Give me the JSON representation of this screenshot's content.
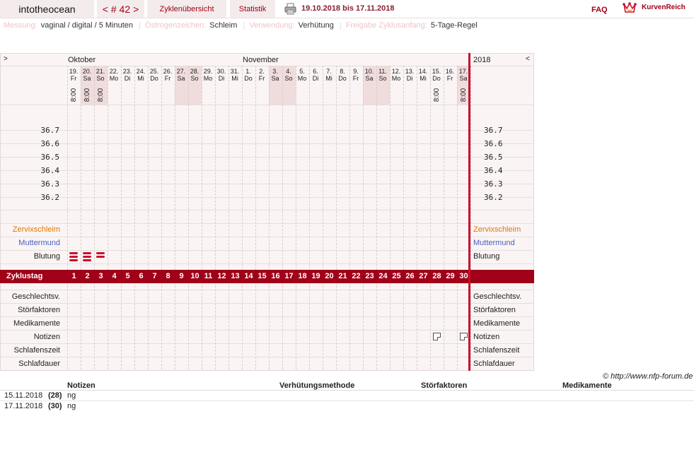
{
  "header": {
    "username": "intotheocean",
    "nav": {
      "prev": "<",
      "cycle": "# 42",
      "next": ">"
    },
    "tabs": [
      "Zyklenübersicht",
      "Statistik"
    ],
    "print_icon": "printer-icon",
    "date_range": "19.10.2018 bis 17.11.2018",
    "faq": "FAQ",
    "brand": "KurvenReich",
    "brand_icon": "crown-icon"
  },
  "info": [
    {
      "label": "Messung:",
      "value": "vaginal / digital / 5 Minuten"
    },
    {
      "label": "Östrogenzeichen:",
      "value": "Schleim"
    },
    {
      "label": "Verwendung:",
      "value": "Verhütung"
    },
    {
      "label": "Freigabe Zyklusanfang:",
      "value": "5-Tage-Regel"
    }
  ],
  "chart": {
    "nav_left": ">",
    "nav_right": "<",
    "month1": "Oktober",
    "month2": "November",
    "year": "2018",
    "days": [
      {
        "d": "19.",
        "w": "Fr",
        "t": "8:00",
        "we": false
      },
      {
        "d": "20.",
        "w": "Sa",
        "t": "8:00",
        "we": true
      },
      {
        "d": "21.",
        "w": "So",
        "t": "8:00",
        "we": true
      },
      {
        "d": "22.",
        "w": "Mo",
        "t": "",
        "we": false
      },
      {
        "d": "23.",
        "w": "Di",
        "t": "",
        "we": false
      },
      {
        "d": "24.",
        "w": "Mi",
        "t": "",
        "we": false
      },
      {
        "d": "25.",
        "w": "Do",
        "t": "",
        "we": false
      },
      {
        "d": "26.",
        "w": "Fr",
        "t": "",
        "we": false
      },
      {
        "d": "27.",
        "w": "Sa",
        "t": "",
        "we": true
      },
      {
        "d": "28.",
        "w": "So",
        "t": "",
        "we": true
      },
      {
        "d": "29.",
        "w": "Mo",
        "t": "",
        "we": false
      },
      {
        "d": "30.",
        "w": "Di",
        "t": "",
        "we": false
      },
      {
        "d": "31.",
        "w": "Mi",
        "t": "",
        "we": false
      },
      {
        "d": "1.",
        "w": "Do",
        "t": "",
        "we": false
      },
      {
        "d": "2.",
        "w": "Fr",
        "t": "",
        "we": false
      },
      {
        "d": "3.",
        "w": "Sa",
        "t": "",
        "we": true
      },
      {
        "d": "4.",
        "w": "So",
        "t": "",
        "we": true
      },
      {
        "d": "5.",
        "w": "Mo",
        "t": "",
        "we": false
      },
      {
        "d": "6.",
        "w": "Di",
        "t": "",
        "we": false
      },
      {
        "d": "7.",
        "w": "Mi",
        "t": "",
        "we": false
      },
      {
        "d": "8.",
        "w": "Do",
        "t": "",
        "we": false
      },
      {
        "d": "9.",
        "w": "Fr",
        "t": "",
        "we": false
      },
      {
        "d": "10.",
        "w": "Sa",
        "t": "",
        "we": true
      },
      {
        "d": "11.",
        "w": "So",
        "t": "",
        "we": true
      },
      {
        "d": "12.",
        "w": "Mo",
        "t": "",
        "we": false
      },
      {
        "d": "13.",
        "w": "Di",
        "t": "",
        "we": false
      },
      {
        "d": "14.",
        "w": "Mi",
        "t": "",
        "we": false
      },
      {
        "d": "15.",
        "w": "Do",
        "t": "8:00",
        "we": false
      },
      {
        "d": "16.",
        "w": "Fr",
        "t": "",
        "we": false
      },
      {
        "d": "17.",
        "w": "Sa",
        "t": "8:00",
        "we": true
      }
    ],
    "temps": [
      "36.7",
      "36.6",
      "36.5",
      "36.4",
      "36.3",
      "36.2"
    ],
    "rows": {
      "zervix": "Zervixschleim",
      "muttermund": "Muttermund",
      "blutung": "Blutung",
      "zyklustag": "Zyklustag",
      "geschlechtsv": "Geschlechtsv.",
      "stoerfaktoren": "Störfaktoren",
      "medikamente": "Medikamente",
      "notizen": "Notizen",
      "schlafenszeit": "Schlafenszeit",
      "schlafdauer": "Schlafdauer"
    },
    "bleeding_days": [
      1,
      2,
      3
    ],
    "note_days": [
      28,
      30
    ],
    "copyright": "© http://www.nfp-forum.de"
  },
  "notes_table": {
    "headers": [
      "Notizen",
      "Verhütungsmethode",
      "Störfaktoren",
      "Medikamente"
    ],
    "rows": [
      {
        "date": "15.11.2018",
        "day": "(28)",
        "note": "ng"
      },
      {
        "date": "17.11.2018",
        "day": "(30)",
        "note": "ng"
      }
    ]
  },
  "colors": {
    "accent": "#a00018",
    "zervix": "#e07800",
    "muttermund": "#4a5fc0",
    "weekend_bg": "#f0dcdc",
    "chart_bg": "#faf4f4"
  }
}
